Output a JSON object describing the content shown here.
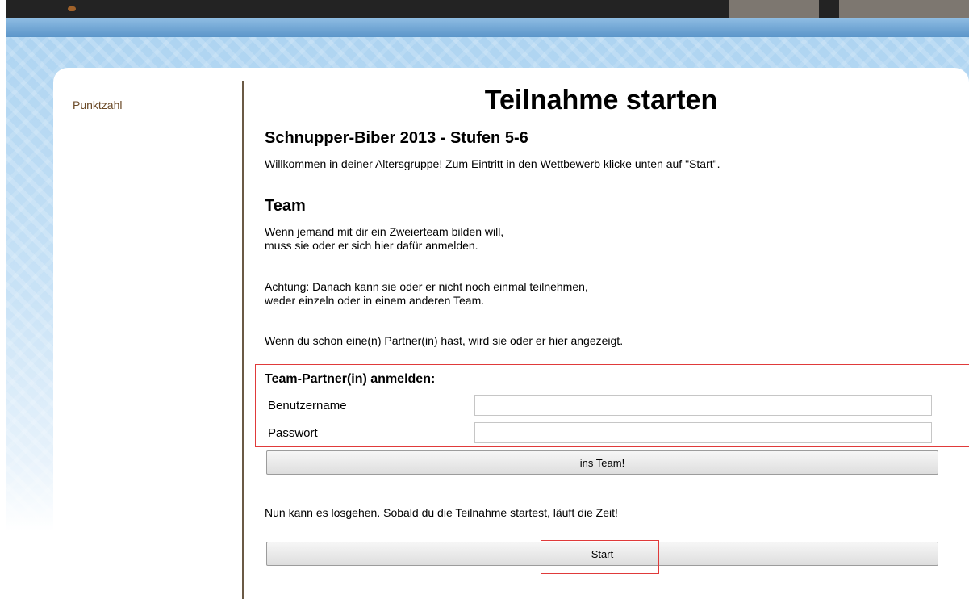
{
  "sidebar": {
    "link_label": "Punktzahl"
  },
  "main": {
    "title": "Teilnahme starten",
    "subtitle": "Schnupper-Biber 2013 - Stufen 5-6",
    "welcome_text": "Willkommen in deiner Altersgruppe! Zum Eintritt in den Wettbewerb klicke unten auf \"Start\".",
    "team": {
      "heading": "Team",
      "para1_line1": "Wenn jemand mit dir ein Zweierteam bilden will,",
      "para1_line2": "muss sie oder er sich hier dafür anmelden.",
      "para2_line1": "Achtung: Danach kann sie oder er nicht noch einmal teilnehmen,",
      "para2_line2": "weder einzeln oder in einem anderen Team.",
      "para3": "Wenn du schon eine(n) Partner(in) hast, wird sie oder er hier angezeigt."
    },
    "team_form": {
      "title": "Team-Partner(in) anmelden:",
      "username_label": "Benutzername",
      "username_value": "",
      "password_label": "Passwort",
      "password_value": "",
      "submit_label": "ins Team!"
    },
    "start_text": "Nun kann es losgehen. Sobald du die Teilnahme startest, läuft die Zeit!",
    "start_button_label": "Start"
  },
  "colors": {
    "sidebar_link": "#6b4a28",
    "divider": "#6b5a45",
    "highlight_border": "#e03a3a",
    "header_blue": "#5b95c9"
  }
}
